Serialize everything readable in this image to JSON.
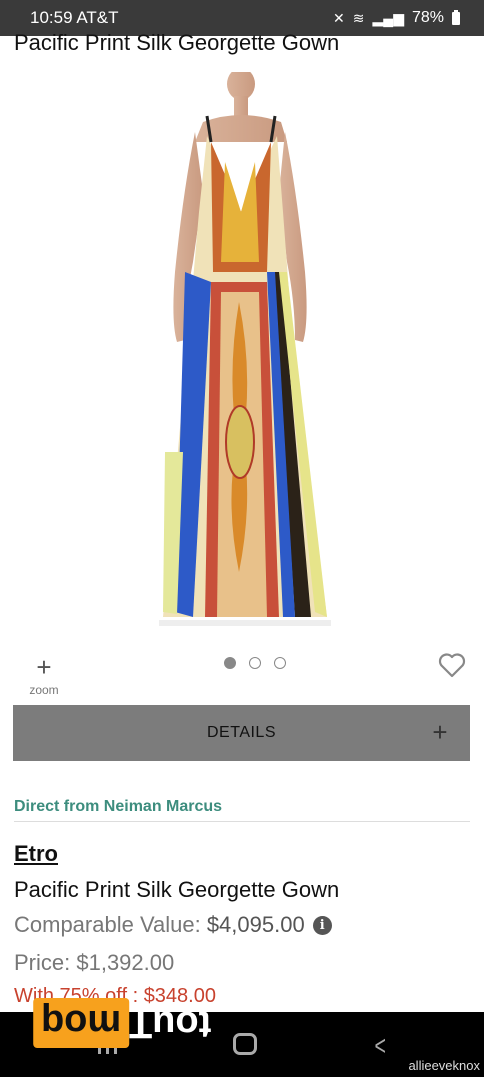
{
  "status_bar": {
    "time_carrier": "10:59 AT&T",
    "battery": "78%",
    "icons": [
      "mute-icon",
      "wifi-icon",
      "signal-icon",
      "battery-icon"
    ]
  },
  "product": {
    "page_title": "Pacific Print Silk Georgette Gown",
    "zoom_label": "zoom",
    "details_label": "DETAILS",
    "direct_from": "Direct from Neiman Marcus",
    "brand": "Etro",
    "name": "Pacific Print Silk Georgette Gown",
    "comparable_label": "Comparable Value: ",
    "comparable_value": "$4,095.00",
    "price_label": "Price: ",
    "price_value": "$1,392.00",
    "discount_text": "With 75% off : $348.00"
  },
  "carousel": {
    "total": 3,
    "active": 1
  },
  "watermark": {
    "logo_left": "moq",
    "logo_right": "touT",
    "user": "allieeveknox"
  },
  "colors": {
    "status_bar_bg": "#3a3a3a",
    "details_bg": "#7c7c7c",
    "accent_green": "#3d8d7e",
    "discount_red": "#c8422e"
  }
}
